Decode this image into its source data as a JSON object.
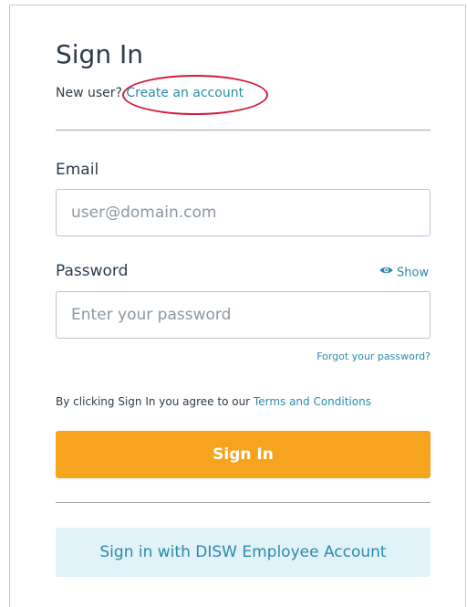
{
  "header": {
    "title": "Sign In",
    "new_user_text": "New user?",
    "create_account_link": "Create an account"
  },
  "form": {
    "email_label": "Email",
    "email_placeholder": "user@domain.com",
    "email_value": "",
    "password_label": "Password",
    "password_placeholder": "Enter your password",
    "password_value": "",
    "show_label": "Show",
    "forgot_link": "Forgot your password?",
    "agree_text": "By clicking Sign In you agree to our ",
    "terms_link": "Terms and Conditions",
    "signin_button": "Sign In",
    "employee_button": "Sign in with DISW Employee Account"
  },
  "icons": {
    "show": "eye-icon"
  },
  "colors": {
    "accent": "#f6a41e",
    "link": "#2b8bab",
    "text": "#2d3c4a",
    "annotation": "#d01c3c",
    "employee_bg": "#e1f2f8"
  }
}
